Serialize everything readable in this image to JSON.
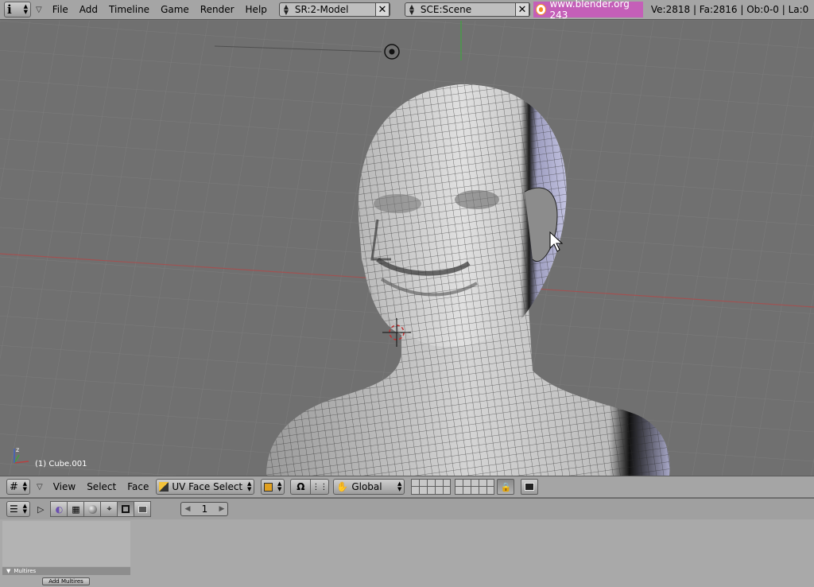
{
  "topbar": {
    "menus": [
      "File",
      "Add",
      "Timeline",
      "Game",
      "Render",
      "Help"
    ],
    "screen_field": "SR:2-Model",
    "scene_field": "SCE:Scene",
    "website": "www.blender.org 243",
    "stats": "Ve:2818 | Fa:2816 | Ob:0-0 | La:0"
  },
  "viewport": {
    "object_label": "(1) Cube.001"
  },
  "header3d": {
    "view_menu": "View",
    "select_menu": "Select",
    "face_menu": "Face",
    "mode_select": "UV Face Select",
    "orientation_select": "Global"
  },
  "buttonsbar": {
    "frame_number": "1"
  },
  "panel": {
    "title": "Multires",
    "add_button": "Add Multires"
  },
  "colors": {
    "website_bg": "#c45fb8",
    "window_bg": "#a5a5a5",
    "viewport_bg": "#707070",
    "x_axis": "#b84040",
    "y_axis": "#40b040"
  }
}
